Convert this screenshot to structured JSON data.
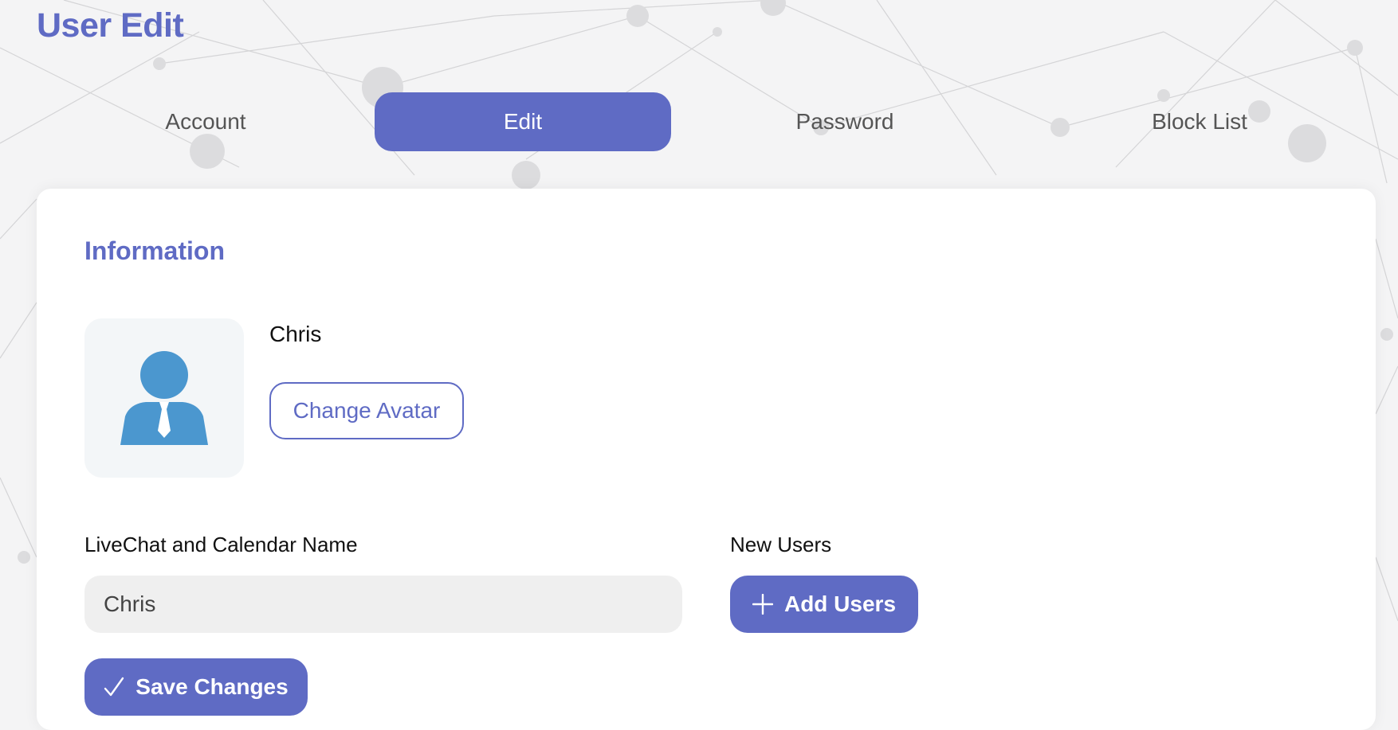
{
  "page": {
    "title": "User Edit"
  },
  "tabs": [
    {
      "label": "Account",
      "active": false
    },
    {
      "label": "Edit",
      "active": true
    },
    {
      "label": "Password",
      "active": false
    },
    {
      "label": "Block List",
      "active": false
    }
  ],
  "information": {
    "title": "Information",
    "avatar_icon": "user-avatar-icon",
    "user_name": "Chris",
    "change_avatar_label": "Change Avatar"
  },
  "livechat": {
    "label": "LiveChat and Calendar Name",
    "value": "Chris"
  },
  "new_users": {
    "label": "New Users",
    "add_label": "Add Users",
    "add_icon": "plus-icon"
  },
  "save": {
    "label": "Save Changes",
    "icon": "check-icon"
  },
  "colors": {
    "accent": "#5f6bc4",
    "avatar_blue": "#4b97cf",
    "input_bg": "#efefef"
  }
}
